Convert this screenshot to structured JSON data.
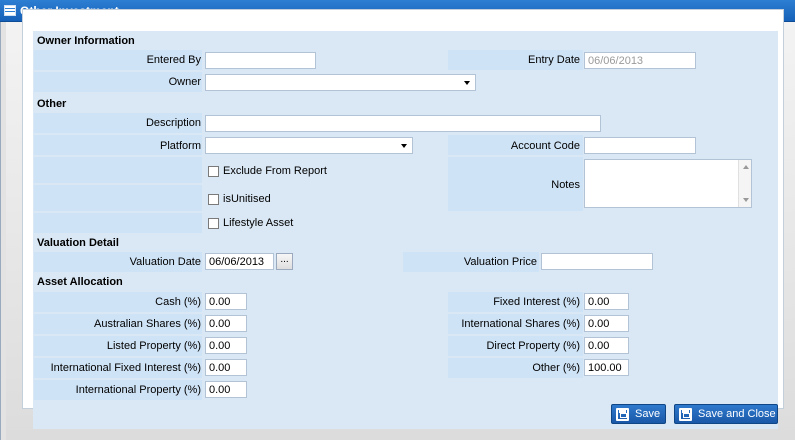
{
  "window": {
    "title": "Other Investment"
  },
  "owner_info": {
    "heading": "Owner Information",
    "entered_by_label": "Entered By",
    "entered_by_value": "",
    "entry_date_label": "Entry Date",
    "entry_date_value": "06/06/2013",
    "owner_label": "Owner",
    "owner_value": ""
  },
  "other": {
    "heading": "Other",
    "description_label": "Description",
    "description_value": "",
    "platform_label": "Platform",
    "platform_value": "",
    "account_code_label": "Account Code",
    "account_code_value": "",
    "exclude_label": "Exclude From Report",
    "isunitised_label": "isUnitised",
    "lifestyle_label": "Lifestyle Asset",
    "notes_label": "Notes",
    "notes_value": ""
  },
  "valuation": {
    "heading": "Valuation Detail",
    "date_label": "Valuation Date",
    "date_value": "06/06/2013",
    "date_button": "...",
    "price_label": "Valuation Price",
    "price_value": ""
  },
  "allocation": {
    "heading": "Asset Allocation",
    "left": [
      {
        "label": "Cash (%)",
        "value": "0.00"
      },
      {
        "label": "Australian Shares (%)",
        "value": "0.00"
      },
      {
        "label": "Listed Property (%)",
        "value": "0.00"
      },
      {
        "label": "International Fixed Interest (%)",
        "value": "0.00"
      },
      {
        "label": "International Property (%)",
        "value": "0.00"
      }
    ],
    "right": [
      {
        "label": "Fixed Interest (%)",
        "value": "0.00"
      },
      {
        "label": "International Shares (%)",
        "value": "0.00"
      },
      {
        "label": "Direct Property (%)",
        "value": "0.00"
      },
      {
        "label": "Other (%)",
        "value": "100.00"
      }
    ]
  },
  "buttons": {
    "save": "Save",
    "save_close": "Save and Close"
  },
  "colors": {
    "titlebar": "#1f6ec5",
    "panel": "#dae8f5",
    "cell": "#cfe3f6",
    "button": "#1f63b4"
  }
}
